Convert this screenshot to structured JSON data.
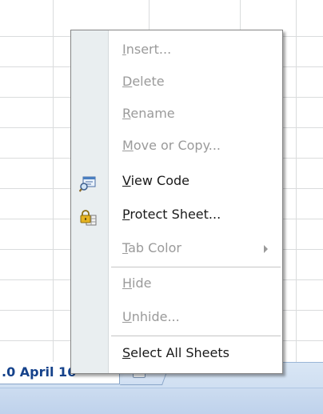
{
  "sheet_tab": {
    "label": ".0 April 16"
  },
  "context_menu": {
    "items": [
      {
        "first": "I",
        "rest": "nsert...",
        "enabled": false
      },
      {
        "first": "D",
        "rest": "elete",
        "enabled": false
      },
      {
        "first": "R",
        "rest": "ename",
        "enabled": false
      },
      {
        "first": "M",
        "rest": "ove or Copy...",
        "enabled": false
      },
      {
        "first": "V",
        "rest": "iew Code",
        "enabled": true,
        "icon": "view-code-icon"
      },
      {
        "first": "P",
        "rest": "rotect Sheet...",
        "enabled": true,
        "icon": "protect-sheet-lock-icon"
      },
      {
        "first": "T",
        "rest": "ab Color",
        "enabled": false,
        "submenu": true
      },
      {
        "first": "H",
        "rest": "ide",
        "enabled": false
      },
      {
        "first": "U",
        "rest": "nhide...",
        "enabled": false
      },
      {
        "first": "S",
        "rest": "elect All Sheets",
        "enabled": true
      }
    ]
  }
}
